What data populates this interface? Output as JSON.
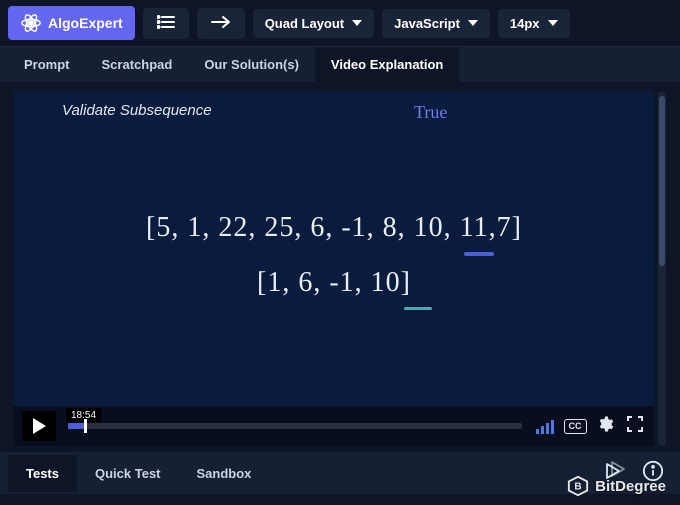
{
  "brand": {
    "name": "AlgoExpert"
  },
  "toolbar": {
    "layout_label": "Quad Layout",
    "language_label": "JavaScript",
    "fontsize_label": "14px"
  },
  "tabs": {
    "prompt": "Prompt",
    "scratchpad": "Scratchpad",
    "solutions": "Our Solution(s)",
    "video": "Video Explanation"
  },
  "video": {
    "title": "Validate Subsequence",
    "annotation_true": "True",
    "array_main": "[5, 1, 22, 25, 6, -1, 8, 10, 11,7]",
    "array_sub": "[1, 6, -1, 10]",
    "timestamp": "18:54",
    "cc_label": "CC"
  },
  "bottom_tabs": {
    "tests": "Tests",
    "quick_test": "Quick Test",
    "sandbox": "Sandbox"
  },
  "watermark": {
    "text": "BitDegree"
  }
}
